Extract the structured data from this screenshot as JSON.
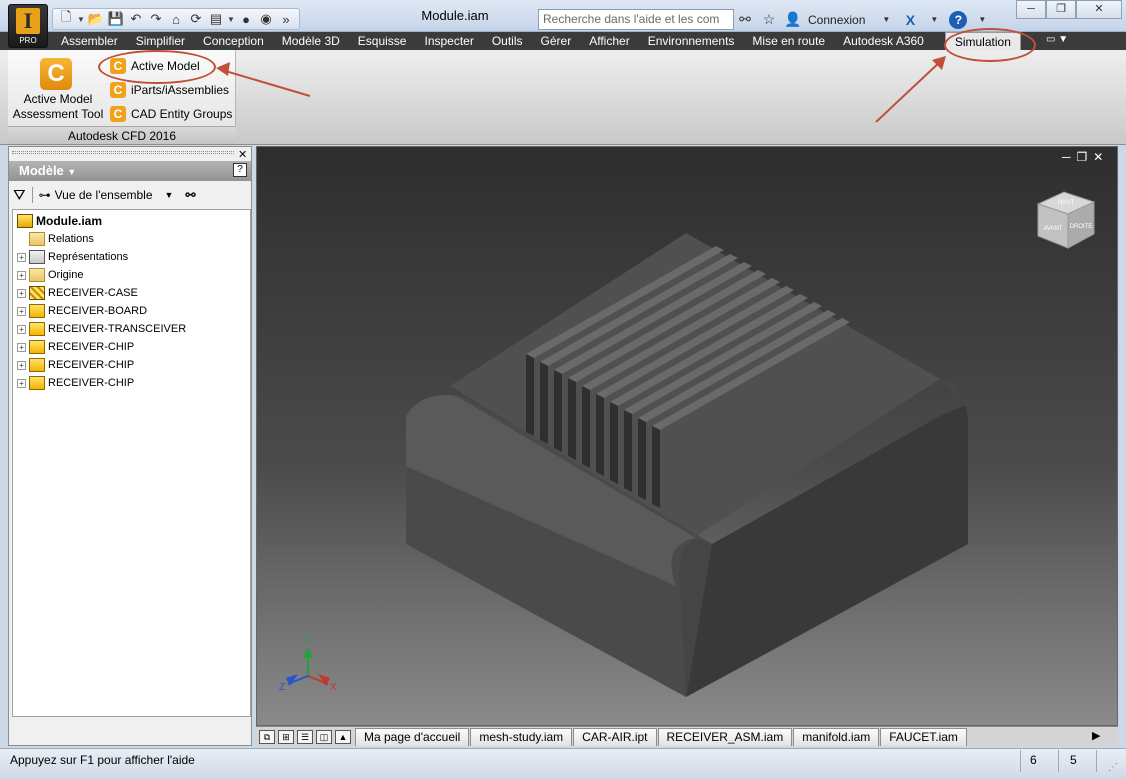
{
  "app": {
    "document_title": "Module.iam",
    "badge": "PRO",
    "logo_letter": "I"
  },
  "search": {
    "placeholder": "Recherche dans l'aide et les com"
  },
  "header": {
    "login_label": "Connexion",
    "help_label": "?"
  },
  "ribbon": {
    "tabs": [
      {
        "label": "Assembler"
      },
      {
        "label": "Simplifier"
      },
      {
        "label": "Conception"
      },
      {
        "label": "Modèle 3D"
      },
      {
        "label": "Esquisse"
      },
      {
        "label": "Inspecter"
      },
      {
        "label": "Outils"
      },
      {
        "label": "Gérer"
      },
      {
        "label": "Afficher"
      },
      {
        "label": "Environnements"
      },
      {
        "label": "Mise en route"
      },
      {
        "label": "Autodesk A360"
      },
      {
        "label": "Simulation",
        "active": true
      }
    ],
    "panel": {
      "big_button_label": "Active Model Assessment Tool",
      "commands": [
        {
          "label": "Active Model"
        },
        {
          "label": "iParts/iAssemblies"
        },
        {
          "label": "CAD Entity Groups"
        }
      ],
      "group_label": "Autodesk CFD 2016",
      "icon_letter": "C"
    }
  },
  "browser": {
    "title": "Modèle",
    "view_label": "Vue de l'ensemble",
    "help_label": "?",
    "tree": [
      {
        "label": "Module.iam",
        "icon": "assembly-icon",
        "root": true
      },
      {
        "label": "Relations",
        "icon": "folder-icon",
        "expandable": false
      },
      {
        "label": "Représentations",
        "icon": "representations-icon",
        "expandable": true
      },
      {
        "label": "Origine",
        "icon": "folder-icon",
        "expandable": true
      },
      {
        "label": "RECEIVER-CASE",
        "icon": "grounded-part-icon",
        "expandable": true
      },
      {
        "label": "RECEIVER-BOARD",
        "icon": "part-icon",
        "expandable": true
      },
      {
        "label": "RECEIVER-TRANSCEIVER",
        "icon": "part-icon",
        "expandable": true
      },
      {
        "label": "RECEIVER-CHIP",
        "icon": "part-icon",
        "expandable": true
      },
      {
        "label": "RECEIVER-CHIP",
        "icon": "part-icon",
        "expandable": true
      },
      {
        "label": "RECEIVER-CHIP",
        "icon": "part-icon",
        "expandable": true
      }
    ]
  },
  "viewcube": {
    "top": "HAUT",
    "front": "AVANT",
    "right": "DROITE"
  },
  "triad": {
    "x": "X",
    "y": "Y",
    "z": "Z"
  },
  "document_tabs": [
    {
      "label": "Ma page d'accueil"
    },
    {
      "label": "mesh-study.iam"
    },
    {
      "label": "CAR-AIR.ipt"
    },
    {
      "label": "RECEIVER_ASM.iam"
    },
    {
      "label": "manifold.iam"
    },
    {
      "label": "FAUCET.iam"
    }
  ],
  "status": {
    "text": "Appuyez sur F1 pour afficher l'aide",
    "count1": "6",
    "count2": "5"
  },
  "colors": {
    "annotation": "#c0503a",
    "ribbon_dark": "#3b3b3b",
    "cfd_orange": "#f0a21c",
    "model_gray": "#545454"
  }
}
